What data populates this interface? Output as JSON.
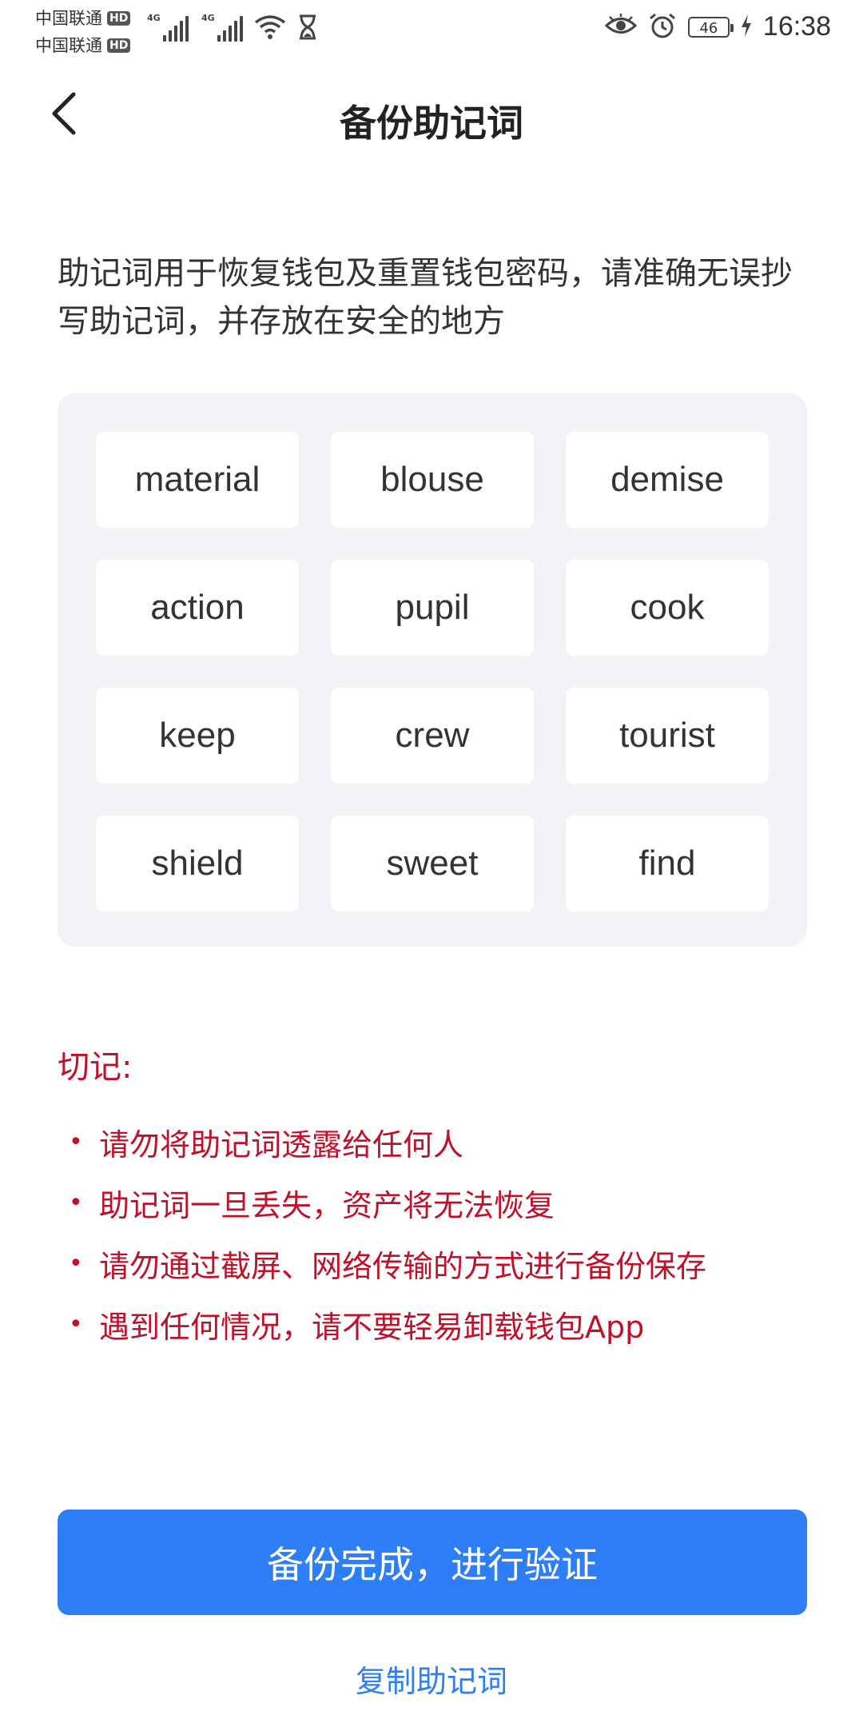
{
  "status_bar": {
    "carrier_1": "中国联通",
    "carrier_2": "中国联通",
    "hd_badge": "HD",
    "network_1": "4G",
    "network_2": "4G",
    "battery": "46",
    "time": "16:38",
    "icons": [
      "signal-icon",
      "wifi-icon",
      "hourglass-icon",
      "eye-icon",
      "alarm-icon",
      "battery-icon",
      "charging-icon"
    ]
  },
  "header": {
    "title": "备份助记词",
    "back_icon": "chevron-left-icon"
  },
  "description": "助记词用于恢复钱包及重置钱包密码，请准确无误抄写助记词，并存放在安全的地方",
  "words": [
    "material",
    "blouse",
    "demise",
    "action",
    "pupil",
    "cook",
    "keep",
    "crew",
    "tourist",
    "shield",
    "sweet",
    "find"
  ],
  "warning": {
    "title": "切记:",
    "bullet": "•",
    "items": [
      "请勿将助记词透露给任何人",
      "助记词一旦丢失，资产将无法恢复",
      "请勿通过截屏、网络传输的方式进行备份保存",
      "遇到任何情况，请不要轻易卸载钱包App"
    ]
  },
  "actions": {
    "primary": "备份完成，进行验证",
    "copy": "复制助记词"
  },
  "colors": {
    "accent": "#2e7ef7",
    "warning": "#c0102a",
    "panel_bg": "#f1f3f7"
  }
}
